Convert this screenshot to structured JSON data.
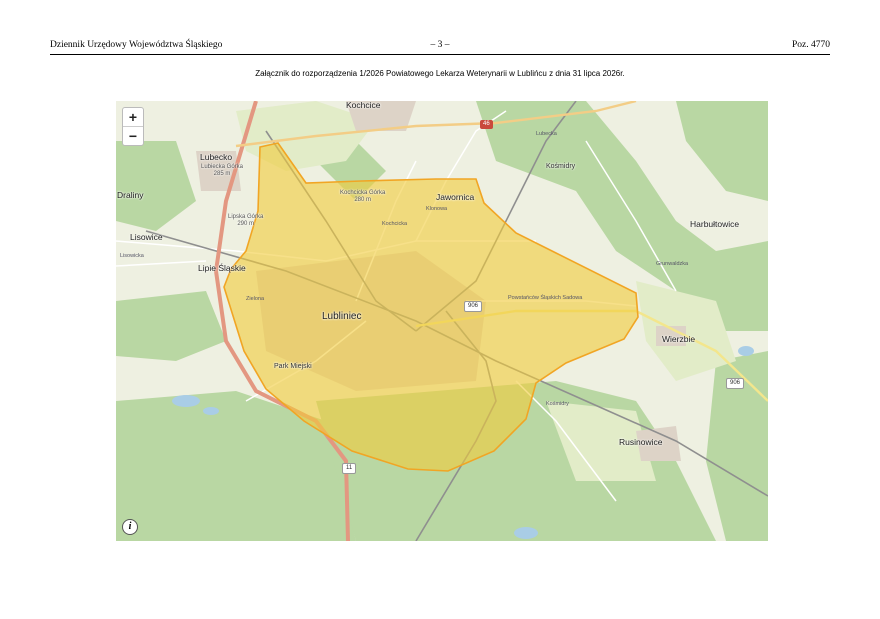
{
  "header": {
    "left": "Dziennik Urzędowy Województwa Śląskiego",
    "center": "– 3 –",
    "right": "Poz. 4770"
  },
  "caption": "Załącznik do rozporządzenia 1/2026 Powiatowego Lekarza Weterynarii w Lublińcu z dnia 31 lipca 2026r.",
  "map": {
    "zoom_in": "+",
    "zoom_out": "−",
    "info": "i",
    "zone_color": "#f2cc3a",
    "places": {
      "kochcice": "Kochcice",
      "lubecko": "Lubecko",
      "draliny": "Draliny",
      "lisowice": "Lisowice",
      "lipie_slaskie": "Lipie Śląskie",
      "lubliniec": "Lubliniec",
      "jawornica": "Jawornica",
      "harbultowice": "Harbułtowice",
      "wierzbie": "Wierzbie",
      "kosmidry": "Kośmidry",
      "rusinowice": "Rusinowice",
      "park_miejski": "Park Miejski"
    },
    "peaks": {
      "lubiecka_gorka": "Lubiecka Górka",
      "lubiecka_gorka_h": "285 m",
      "kochcicka_gorka": "Kochcicka Górka",
      "kochcicka_gorka_h": "280 m",
      "lipska_gorka": "Lipska Górka",
      "lipska_gorka_h": "290 m"
    },
    "roads": {
      "r46": "46",
      "r906a": "906",
      "r906b": "906",
      "r11": "11",
      "street_sadowa": "Powstańców Śląskich Sadowa",
      "street_kochcicka": "Kochcicka",
      "street_lubecka": "Lubecka",
      "street_kosmidry": "Kośmidry",
      "street_lisowicka": "Lisowicka",
      "street_zielona": "Zielona",
      "street_klonowa": "Klonowa",
      "street_grunwaldzka": "Grunwaldzka"
    }
  }
}
